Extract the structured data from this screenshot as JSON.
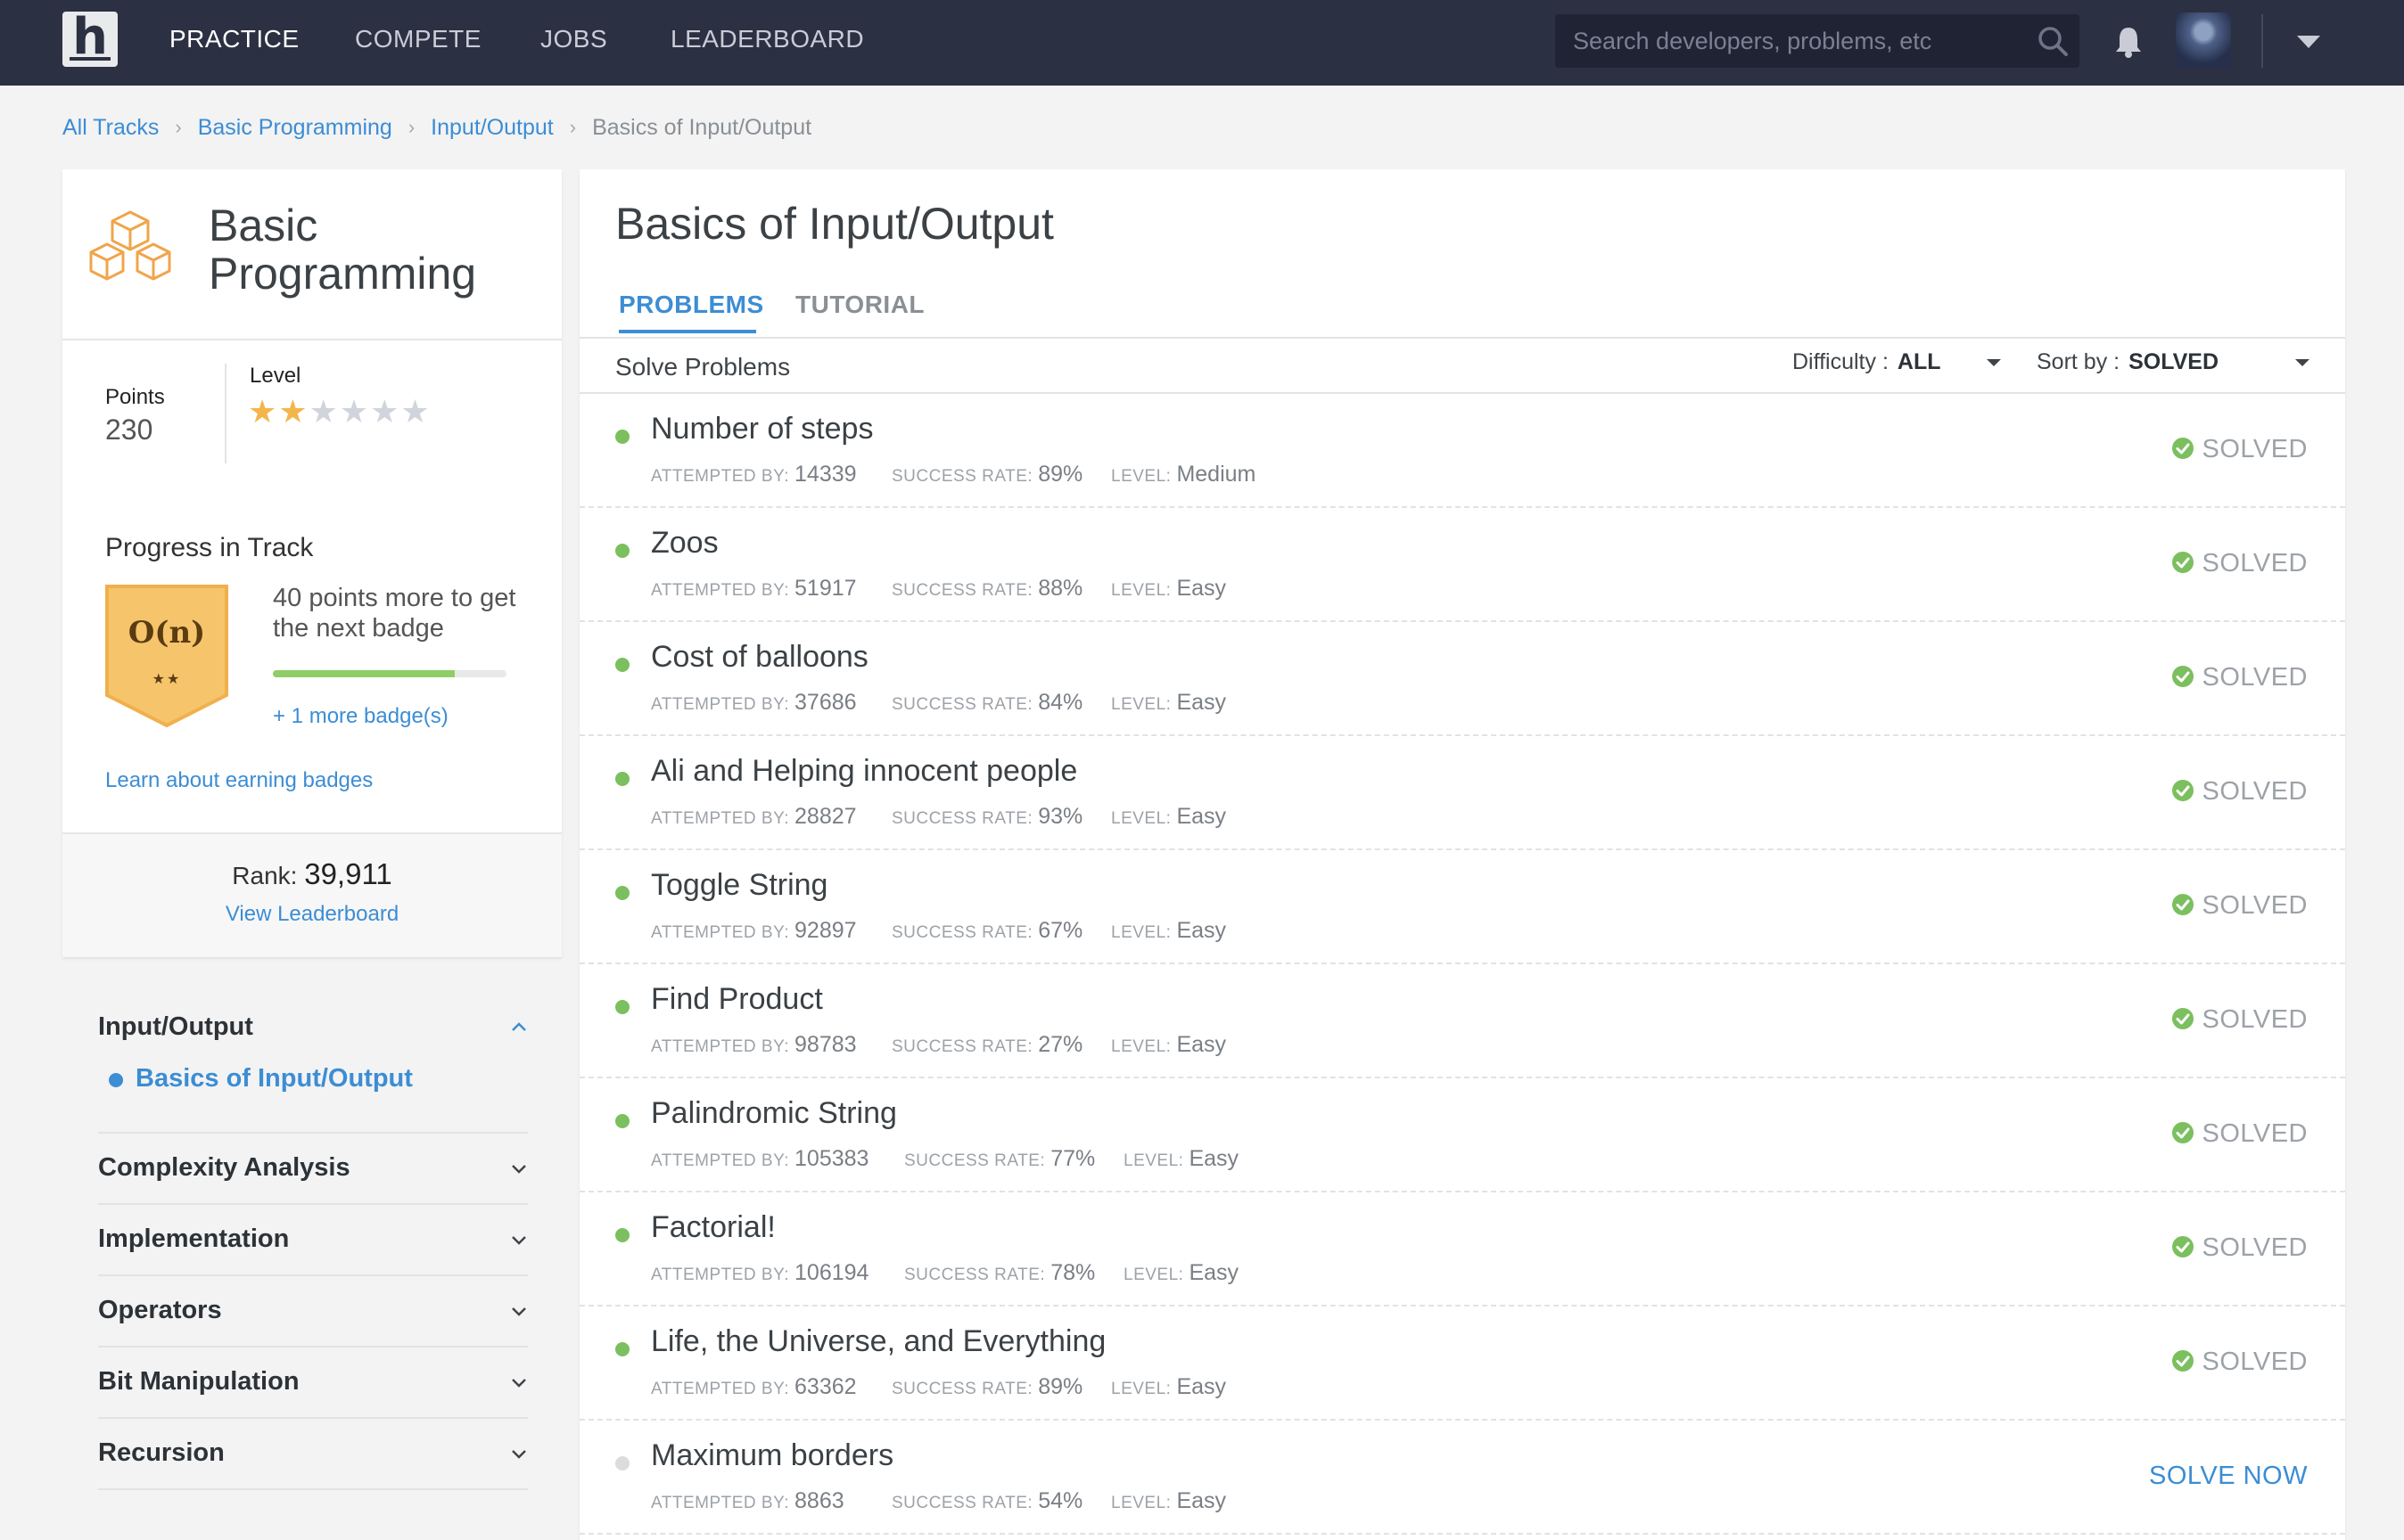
{
  "nav": {
    "logo": "h",
    "links": [
      "PRACTICE",
      "COMPETE",
      "JOBS",
      "LEADERBOARD"
    ],
    "search_placeholder": "Search developers, problems, etc",
    "accent": "#3c8dd4",
    "bar_color": "#2b3042"
  },
  "breadcrumb": [
    "All Tracks",
    "Basic Programming",
    "Input/Output",
    "Basics of Input/Output"
  ],
  "sidebar": {
    "track_title": "Basic Programming",
    "points_label": "Points",
    "points_value": "230",
    "level_label": "Level",
    "level_stars_filled": 2,
    "level_stars_total": 6,
    "progress_title": "Progress in Track",
    "badge_text": "O(n)",
    "badge_stars": "★★",
    "next_badge_text": "40 points more to get the next badge",
    "progress_fraction": 0.78,
    "more_badges": "+ 1 more badge(s)",
    "learn_link": "Learn about earning badges",
    "rank_label": "Rank:",
    "rank_value": "39,911",
    "view_leaderboard": "View Leaderboard"
  },
  "topics": {
    "open_topic": "Input/Output",
    "open_subtopic": "Basics of Input/Output",
    "collapsed": [
      "Complexity Analysis",
      "Implementation",
      "Operators",
      "Bit Manipulation",
      "Recursion"
    ]
  },
  "main": {
    "title": "Basics of Input/Output",
    "tabs": [
      "PROBLEMS",
      "TUTORIAL"
    ],
    "solve_title": "Solve Problems",
    "difficulty_label": "Difficulty :",
    "difficulty_value": "ALL",
    "sort_label": "Sort by :",
    "sort_value": "SOLVED",
    "meta_labels": {
      "attempted": "ATTEMPTED BY:",
      "success": "SUCCESS RATE:",
      "level": "LEVEL:"
    },
    "solved_label": "SOLVED",
    "solve_now_label": "SOLVE NOW",
    "problems": [
      {
        "name": "Number of steps",
        "attempted": "14339",
        "success": "89%",
        "level": "Medium",
        "solved": true
      },
      {
        "name": "Zoos",
        "attempted": "51917",
        "success": "88%",
        "level": "Easy",
        "solved": true
      },
      {
        "name": "Cost of balloons",
        "attempted": "37686",
        "success": "84%",
        "level": "Easy",
        "solved": true
      },
      {
        "name": "Ali and Helping innocent people",
        "attempted": "28827",
        "success": "93%",
        "level": "Easy",
        "solved": true
      },
      {
        "name": "Toggle String",
        "attempted": "92897",
        "success": "67%",
        "level": "Easy",
        "solved": true
      },
      {
        "name": "Find Product",
        "attempted": "98783",
        "success": "27%",
        "level": "Easy",
        "solved": true
      },
      {
        "name": "Palindromic String",
        "attempted": "105383",
        "success": "77%",
        "level": "Easy",
        "solved": true
      },
      {
        "name": "Factorial!",
        "attempted": "106194",
        "success": "78%",
        "level": "Easy",
        "solved": true
      },
      {
        "name": "Life, the Universe, and Everything",
        "attempted": "63362",
        "success": "89%",
        "level": "Easy",
        "solved": true
      },
      {
        "name": "Maximum borders",
        "attempted": "8863",
        "success": "54%",
        "level": "Easy",
        "solved": false
      }
    ],
    "solved_color": "#7bbf5f"
  }
}
